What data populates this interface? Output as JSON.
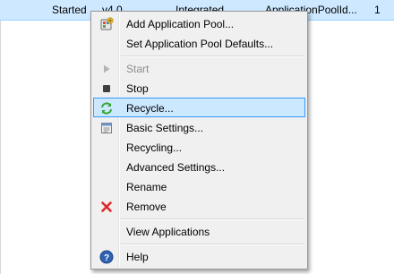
{
  "grid": {
    "row": {
      "status": "Started",
      "version": "v4.0",
      "pipeline": "Integrated",
      "identity": "ApplicationPoolId...",
      "applications": "1"
    }
  },
  "menu": {
    "items": [
      {
        "label": "Add Application Pool...",
        "icon": "add-pool-icon"
      },
      {
        "label": "Set Application Pool Defaults...",
        "icon": ""
      },
      {
        "label": "Start",
        "icon": "start-icon",
        "disabled": true
      },
      {
        "label": "Stop",
        "icon": "stop-icon"
      },
      {
        "label": "Recycle...",
        "icon": "recycle-icon",
        "highlighted": true
      },
      {
        "label": "Basic Settings...",
        "icon": "basic-settings-icon"
      },
      {
        "label": "Recycling...",
        "icon": ""
      },
      {
        "label": "Advanced Settings...",
        "icon": ""
      },
      {
        "label": "Rename",
        "icon": ""
      },
      {
        "label": "Remove",
        "icon": "remove-icon"
      },
      {
        "label": "View Applications",
        "icon": ""
      },
      {
        "label": "Help",
        "icon": "help-icon"
      }
    ]
  },
  "colors": {
    "row_selection": "#cde8ff",
    "menu_highlight": "#cce8ff",
    "menu_highlight_border": "#3399ff",
    "remove_red": "#e0262b",
    "help_blue": "#2f63b2",
    "recycle_green": "#3aa63a"
  }
}
